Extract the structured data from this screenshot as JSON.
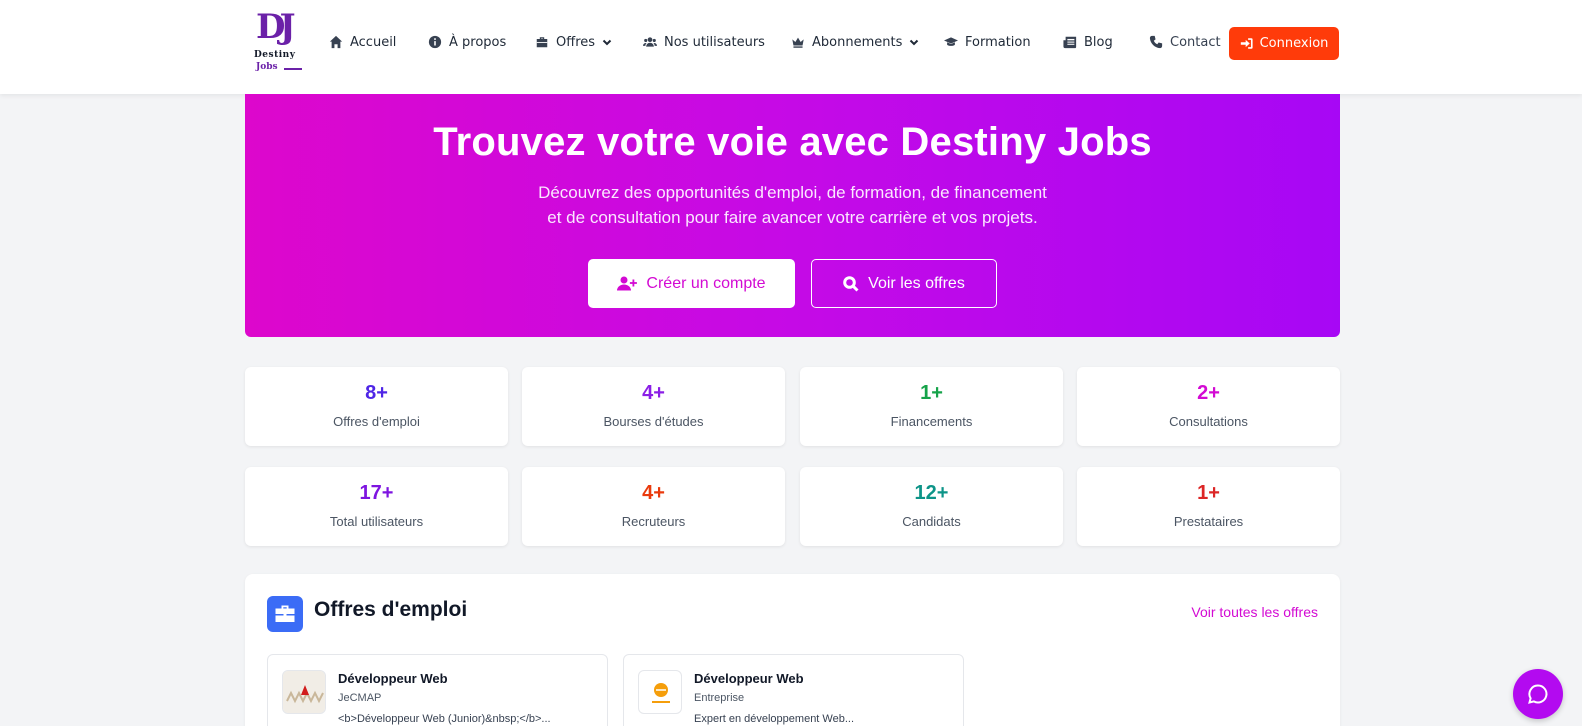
{
  "brand": {
    "mark": "DJ",
    "name": "Destiny",
    "sub": "Jobs"
  },
  "nav": {
    "items": [
      {
        "label": "Accueil",
        "icon": "home-icon"
      },
      {
        "label": "À propos",
        "icon": "info-icon"
      },
      {
        "label": "Offres",
        "icon": "briefcase-icon",
        "dropdown": true
      },
      {
        "label": "Nos utilisateurs",
        "icon": "users-icon"
      },
      {
        "label": "Abonnements",
        "icon": "crown-icon",
        "dropdown": true
      },
      {
        "label": "Formation",
        "icon": "graduation-cap-icon"
      },
      {
        "label": "Blog",
        "icon": "newspaper-icon"
      },
      {
        "label": "Contact",
        "icon": "phone-icon"
      }
    ],
    "login_label": "Connexion"
  },
  "hero": {
    "title": "Trouvez votre voie avec Destiny Jobs",
    "subtitle": "Découvrez des opportunités d'emploi, de formation, de financement et de consultation pour faire avancer votre carrière et vos projets.",
    "primary_button": "Créer un compte",
    "secondary_button": "Voir les offres"
  },
  "stats": [
    {
      "value": "8+",
      "label": "Offres d'emploi",
      "color": "#4f26e6"
    },
    {
      "value": "4+",
      "label": "Bourses d'études",
      "color": "#8b1ee6"
    },
    {
      "value": "1+",
      "label": "Financements",
      "color": "#16a34a"
    },
    {
      "value": "2+",
      "label": "Consultations",
      "color": "#d30ad3"
    },
    {
      "value": "17+",
      "label": "Total utilisateurs",
      "color": "#7e14e0"
    },
    {
      "value": "4+",
      "label": "Recruteurs",
      "color": "#ea3a0c"
    },
    {
      "value": "12+",
      "label": "Candidats",
      "color": "#0d9488"
    },
    {
      "value": "1+",
      "label": "Prestataires",
      "color": "#dc2626"
    }
  ],
  "jobs_section": {
    "title": "Offres d'emploi",
    "see_all": "Voir toutes les offres",
    "jobs": [
      {
        "title": "Développeur Web",
        "company": "JeCMAP",
        "description": "<b>Développeur Web (Junior)&nbsp;</b>..."
      },
      {
        "title": "Développeur Web",
        "company": "Entreprise",
        "description": "Expert en développement Web..."
      }
    ]
  },
  "colors": {
    "accent": "#d30ad3",
    "login": "#ff3b0a",
    "hero_start": "#dd07cc",
    "hero_end": "#a707f5",
    "chat": "#b30af0"
  }
}
